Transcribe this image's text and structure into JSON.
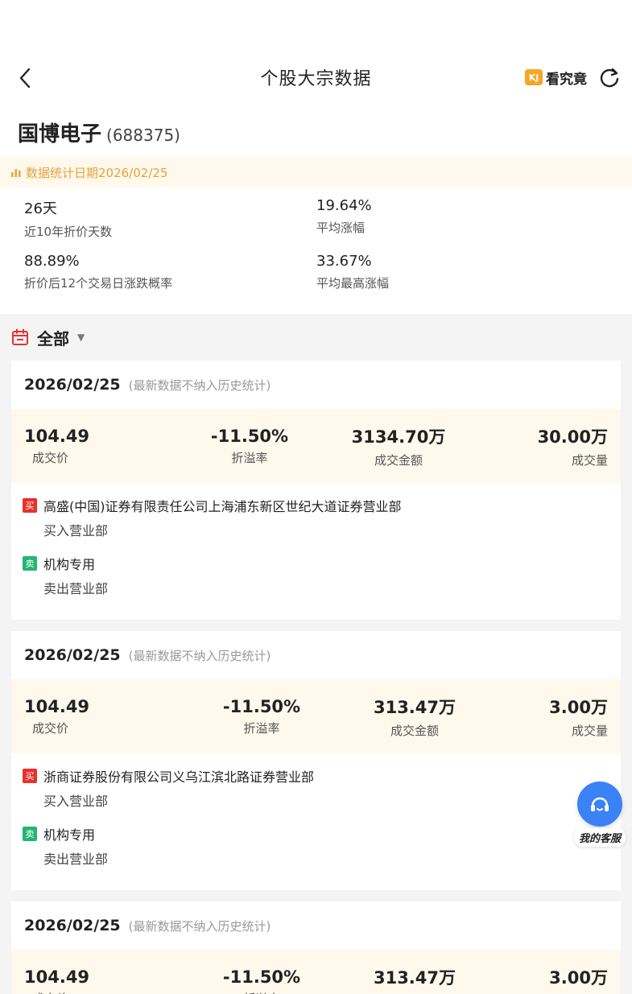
{
  "header": {
    "title": "个股大宗数据",
    "kjj_logo": "KJ",
    "kjj_label": "看究竟"
  },
  "stock": {
    "name": "国博电子",
    "code": "(688375)"
  },
  "banner": {
    "text": "数据统计日期2026/02/25"
  },
  "stats": [
    {
      "value": "26天",
      "label": "近10年折价天数"
    },
    {
      "value": "19.64%",
      "label": "平均涨幅"
    },
    {
      "value": "88.89%",
      "label": "折价后12个交易日涨跌概率"
    },
    {
      "value": "33.67%",
      "label": "平均最高涨幅"
    }
  ],
  "filter": {
    "label": "全部",
    "caret": "▼"
  },
  "metric_labels": {
    "price": "成交价",
    "premium": "折溢率",
    "amount": "成交金额",
    "volume": "成交量"
  },
  "cards": [
    {
      "date": "2026/02/25",
      "note": "(最新数据不纳入历史统计)",
      "price": "104.49",
      "premium": "-11.50%",
      "amount": "3134.70万",
      "volume": "30.00万",
      "buyer": {
        "badge": "买",
        "name": "高盛(中国)证券有限责任公司上海浦东新区世纪大道证券营业部",
        "role": "买入营业部"
      },
      "seller": {
        "badge": "卖",
        "name": "机构专用",
        "role": "卖出营业部"
      }
    },
    {
      "date": "2026/02/25",
      "note": "(最新数据不纳入历史统计)",
      "price": "104.49",
      "premium": "-11.50%",
      "amount": "313.47万",
      "volume": "3.00万",
      "buyer": {
        "badge": "买",
        "name": "浙商证券股份有限公司义乌江滨北路证券营业部",
        "role": "买入营业部"
      },
      "seller": {
        "badge": "卖",
        "name": "机构专用",
        "role": "卖出营业部"
      }
    },
    {
      "date": "2026/02/25",
      "note": "(最新数据不纳入历史统计)",
      "price": "104.49",
      "premium": "-11.50%",
      "amount": "313.47万",
      "volume": "3.00万"
    }
  ],
  "service": {
    "label": "我的客服"
  },
  "colors": {
    "accent": "#e8a23a",
    "banner_bg": "#fff8ec",
    "buy": "#e8312d",
    "sell": "#22b573",
    "service": "#3b82f6"
  }
}
